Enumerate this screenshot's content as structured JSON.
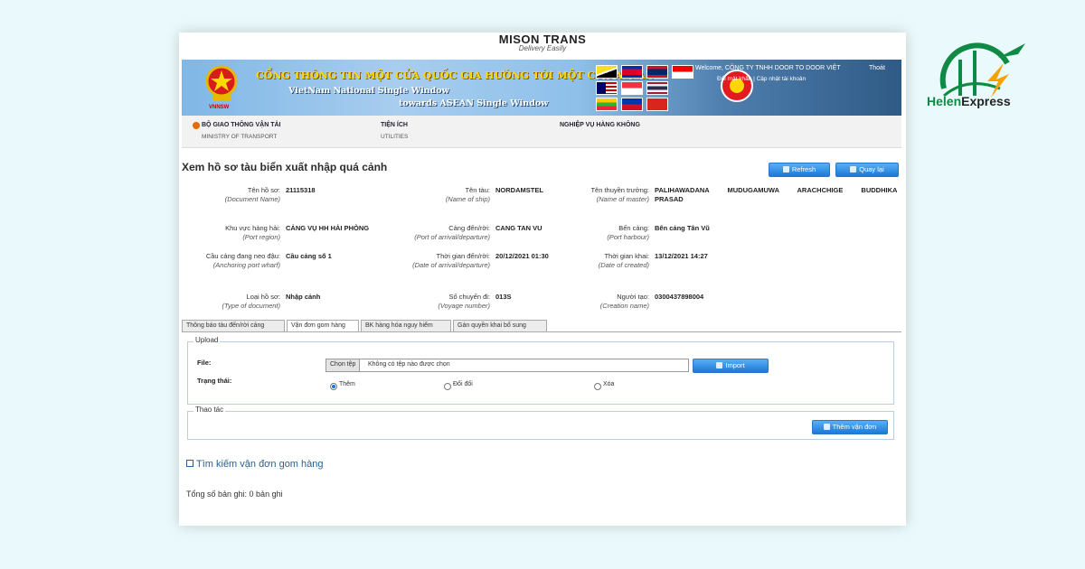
{
  "brand": {
    "name": "MISON TRANS",
    "tagline": "Delivery Easily"
  },
  "banner": {
    "title": "CỔNG THÔNG TIN MỘT CỬA QUỐC GIA HƯỚNG TỚI MỘT CỬA ASEAN",
    "subtitle1": "VietNam National Single Window",
    "subtitle2": "towards ASEAN Single Window",
    "emblem_caption": "VNNSW",
    "user": "Welcome, CÔNG TY TNHH DOOR TO DOOR VIỆT",
    "exit": "Thoát",
    "account": "Đổi mật khẩu | Cập nhật tài khoản"
  },
  "nav": [
    {
      "main": "BỘ GIAO THÔNG VẬN TẢI",
      "sub": "MINISTRY OF TRANSPORT"
    },
    {
      "main": "TIỆN ÍCH",
      "sub": "UTILITIES"
    },
    {
      "main": "NGHIỆP VỤ HÀNG KHÔNG",
      "sub": ""
    }
  ],
  "page": {
    "title": "Xem hồ sơ tàu biển xuất nhập quá cảnh",
    "refresh_label": "Refresh",
    "back_label": "Quay lại"
  },
  "fields": {
    "doc_name": {
      "label": "Tên hồ sơ:",
      "label_en": "(Document Name)",
      "value": "21115318"
    },
    "ship_name": {
      "label": "Tên tàu:",
      "label_en": "(Name of ship)",
      "value": "NORDAMSTEL"
    },
    "master_name": {
      "label": "Tên thuyền trưởng:",
      "label_en": "(Name of master)",
      "value": "PALIHAWADANA MUDUGAMUWA ARACHCHIGE BUDDHIKA PRASAD"
    },
    "port_region": {
      "label": "Khu vực hàng hải:",
      "label_en": "(Port region)",
      "value": "CẢNG VỤ HH HẢI PHÒNG"
    },
    "port_arrival": {
      "label": "Cảng đến/rời:",
      "label_en": "(Port of arrival/departure)",
      "value": "CANG TAN VU"
    },
    "harbour": {
      "label": "Bến cảng:",
      "label_en": "(Port harbour)",
      "value": "Bến cảng Tân Vũ"
    },
    "anchoring": {
      "label": "Cầu cảng đang neo đậu:",
      "label_en": "(Anchoring port wharf)",
      "value": "Cầu cảng số 1"
    },
    "arrival_time": {
      "label": "Thời gian đến/rời:",
      "label_en": "(Date of arrival/departure)",
      "value": "20/12/2021 01:30"
    },
    "created_time": {
      "label": "Thời gian khai:",
      "label_en": "(Date of created)",
      "value": "13/12/2021 14:27"
    },
    "doc_type": {
      "label": "Loại hồ sơ:",
      "label_en": "(Type of document)",
      "value": "Nhập cảnh"
    },
    "voyage": {
      "label": "Số chuyến đi:",
      "label_en": "(Voyage number)",
      "value": "013S"
    },
    "creator": {
      "label": "Người tạo:",
      "label_en": "(Creation name)",
      "value": "0300437898004"
    }
  },
  "tabs": [
    "Thông báo tàu đến/rời cảng",
    "Vận đơn gom hàng",
    "BK hàng hóa nguy hiểm",
    "Gán quyền khai bổ sung"
  ],
  "upload": {
    "legend": "Upload",
    "file_label": "File:",
    "choose_btn": "Chọn tệp",
    "no_file": "Không có tệp nào được chọn",
    "import_label": "Import",
    "status_label": "Trạng thái:",
    "options": [
      "Thêm",
      "Đổi đổi",
      "Xóa"
    ],
    "selected": "Thêm"
  },
  "actions": {
    "legend": "Thao tác",
    "add_label": "Thêm vận đơn"
  },
  "search": {
    "label": "Tìm kiếm vận đơn gom hàng"
  },
  "total": {
    "text": "Tổng số bản ghi: 0 bản ghi"
  },
  "helen_logo": {
    "part1": "Helen",
    "part2": "Express"
  },
  "colors": {
    "accent": "#1b7ad6",
    "banner": "#8ec0ea",
    "helen_green": "#0f8a45",
    "background": "#eaf9fb"
  }
}
